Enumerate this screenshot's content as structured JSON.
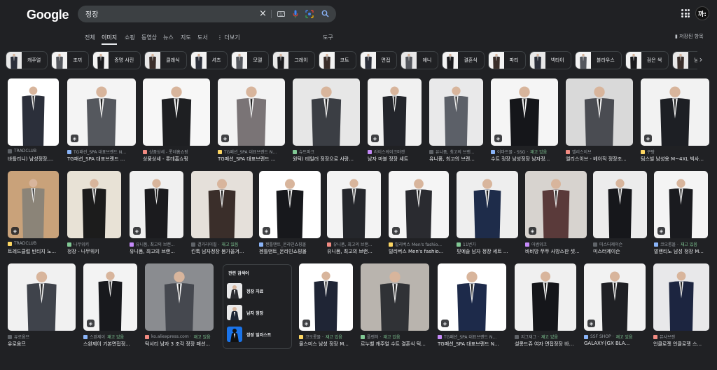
{
  "header": {
    "logo": "Google",
    "query": "정장",
    "avatar_text": "까:"
  },
  "tabs": [
    {
      "label": "전체",
      "active": false
    },
    {
      "label": "이미지",
      "active": true
    },
    {
      "label": "쇼핑",
      "active": false
    },
    {
      "label": "동영상",
      "active": false
    },
    {
      "label": "뉴스",
      "active": false
    },
    {
      "label": "지도",
      "active": false
    },
    {
      "label": "도서",
      "active": false
    },
    {
      "label": "⋮ 더보기",
      "active": false
    }
  ],
  "tools_label": "도구",
  "saved_label": "저장된 항목",
  "chips": [
    "캐주얼",
    "조끼",
    "증명 사진",
    "클래식",
    "셔츠",
    "모델",
    "그레이",
    "코트",
    "면접",
    "애니",
    "결혼식",
    "파티",
    "넥타이",
    "블라우스",
    "검은 색",
    "남자"
  ],
  "rows": [
    [
      {
        "source": "TRADCLUB",
        "caption": "바틀리니) 남성정장,...",
        "bg": "#ffffff",
        "suit": "#2b2f3a",
        "stock": ""
      },
      {
        "source": "TG패션_SPA 대표브랜드 N...",
        "caption": "TG패션_SPA 대표브랜드 ...",
        "bg": "#f4f4f4",
        "suit": "#55585e",
        "stock": ""
      },
      {
        "source": "상품상세 - 롯데홈쇼핑",
        "caption": "상품상세 - 롯데홈쇼핑",
        "bg": "#f7f7f7",
        "suit": "#1e1f22",
        "stock": ""
      },
      {
        "source": "TG패션_SPA 대표브랜드 N...",
        "caption": "TG패션_SPA 대표브랜드 ...",
        "bg": "#f3f3f3",
        "suit": "#7a7476",
        "stock": ""
      },
      {
        "source": "슈트파크",
        "caption": "원턱) 테일러 정장으로 사랑...",
        "bg": "#e7e7e7",
        "suit": "#3b3e44",
        "stock": ""
      },
      {
        "source": "라이스케이크마켓",
        "caption": "남자 마블 정장 세트",
        "bg": "#f1f1f1",
        "suit": "#23252b",
        "stock": ""
      },
      {
        "source": "유니폼, 최고의 브랜...",
        "caption": "유니폼, 최고의 브랜...",
        "bg": "#e9e9ea",
        "suit": "#5c6068",
        "stock": ""
      },
      {
        "source": "이마트몰 - SSG · ",
        "caption": "수트 정장 남성정장 남자정...",
        "bg": "#f5f5f5",
        "suit": "#15161a",
        "stock": "재고 있음"
      },
      {
        "source": "앨리스이브",
        "caption": "엘리스이브 - 베이직 정장조...",
        "bg": "#d9d9d9",
        "suit": "#4a4c52",
        "stock": ""
      },
      {
        "source": "쿠팡",
        "caption": "팀스빌 남성용 M~4XL 빅사...",
        "bg": "#f2f2f2",
        "suit": "#1d1f24",
        "stock": ""
      }
    ],
    [
      {
        "source": "TRADCLUB",
        "caption": "트레드클럽 빈티지 노...",
        "bg": "#c9a27a",
        "suit": "#8b8478",
        "stock": ""
      },
      {
        "source": "나무위키",
        "caption": "정장 - 나무위키",
        "bg": "#e8e2d6",
        "suit": "#1c1c1c",
        "stock": ""
      },
      {
        "source": "유니폼, 최고의 브랜...",
        "caption": "유니폼, 최고의 브랜...",
        "bg": "#f0f0f0",
        "suit": "#1b1b1e",
        "stock": ""
      },
      {
        "source": "결거라이필 · ",
        "caption": "킨톡 남자정장 봄가을겨...",
        "bg": "#e5e0da",
        "suit": "#3a2e2a",
        "stock": "재고 있음"
      },
      {
        "source": "젠틀맨트_온라인쇼핑몰",
        "caption": "젠틀맨트_온라인쇼핑몰",
        "bg": "#ffffff",
        "suit": "#17181c",
        "stock": ""
      },
      {
        "source": "유니폼, 최고의 브랜...",
        "caption": "유니폼, 최고의 브랜...",
        "bg": "#f3f3f3",
        "suit": "#25272c",
        "stock": ""
      },
      {
        "source": "빌리버스 Men's fashio...",
        "caption": "빌리버스 Men's fashio...",
        "bg": "#f5f5f5",
        "suit": "#2a2b30",
        "stock": ""
      },
      {
        "source": "11번가",
        "caption": "핏예솔 남자 정장 세트 ...",
        "bg": "#eeeeee",
        "suit": "#1e2c4a",
        "stock": ""
      },
      {
        "source": "어썸위크",
        "caption": "바비망 쭈쭈 사방스판 셋...",
        "bg": "#d7d3cf",
        "suit": "#5a3a3a",
        "stock": ""
      },
      {
        "source": "미스터제이슨",
        "caption": "미스터제이슨",
        "bg": "#ececec",
        "suit": "#16171b",
        "stock": ""
      },
      {
        "source": "코오롱몰 · ",
        "caption": "발렌티노 남성 정장 M...",
        "bg": "#f4f4f4",
        "suit": "#1a1b1f",
        "stock": "재고 있음"
      }
    ],
    [
      {
        "source": "유로옴므",
        "caption": "유로옴므",
        "bg": "#f1f1f1",
        "suit": "#3f434b",
        "stock": ""
      },
      {
        "source": "스완제이",
        "caption": "스완제이 기본면접정...",
        "bg": "#f3f3f3",
        "suit": "#18191d",
        "stock": "재고 있음"
      },
      {
        "source": "ko.aliexpress.com · ",
        "caption": "턱서티 남자 3 조각 정장 패션...",
        "bg": "#8a8c90",
        "suit": "#45484f",
        "stock": "재고 있음"
      },
      {
        "source": "코오롱몰 · ",
        "caption": "몰스미스 남성 정장 M...",
        "bg": "#ffffff",
        "suit": "#1f2535",
        "stock": "재고 있음"
      },
      {
        "source": "플렌처 · ",
        "caption": "르누벨 캐주얼 수트 결혼식 턱...",
        "bg": "#b9b4ae",
        "suit": "#303236",
        "stock": "재고 있음"
      },
      {
        "source": "TG패션_SPA 대표브랜드 N...",
        "caption": "TG패션_SPA 대표브랜드 N...",
        "bg": "#ffffff",
        "suit": "#1d2a4a",
        "stock": ""
      },
      {
        "source": "지그재그 · ",
        "caption": "설롱드쥬 여자 면접정장 바지 ...",
        "bg": "#f0f0f0",
        "suit": "#15161a",
        "stock": "재고 있음"
      },
      {
        "source": "SSF SHOP · ",
        "caption": "GALAXY-[GX BLA...",
        "bg": "#f2f2f2",
        "suit": "#1f2024",
        "stock": "재고 있음"
      },
      {
        "source": "뮤사브랜",
        "caption": "언클로젯 언클로젯 스...",
        "bg": "#e8e8ea",
        "suit": "#1c2540",
        "stock": ""
      }
    ]
  ],
  "related": {
    "title": "관련 검색어",
    "items": [
      "정장 자료",
      "남자 정장",
      "정장 일러스트"
    ]
  },
  "colors": {
    "background": "#202124",
    "accent": "#8ab4f8",
    "stock": "#81c995"
  }
}
